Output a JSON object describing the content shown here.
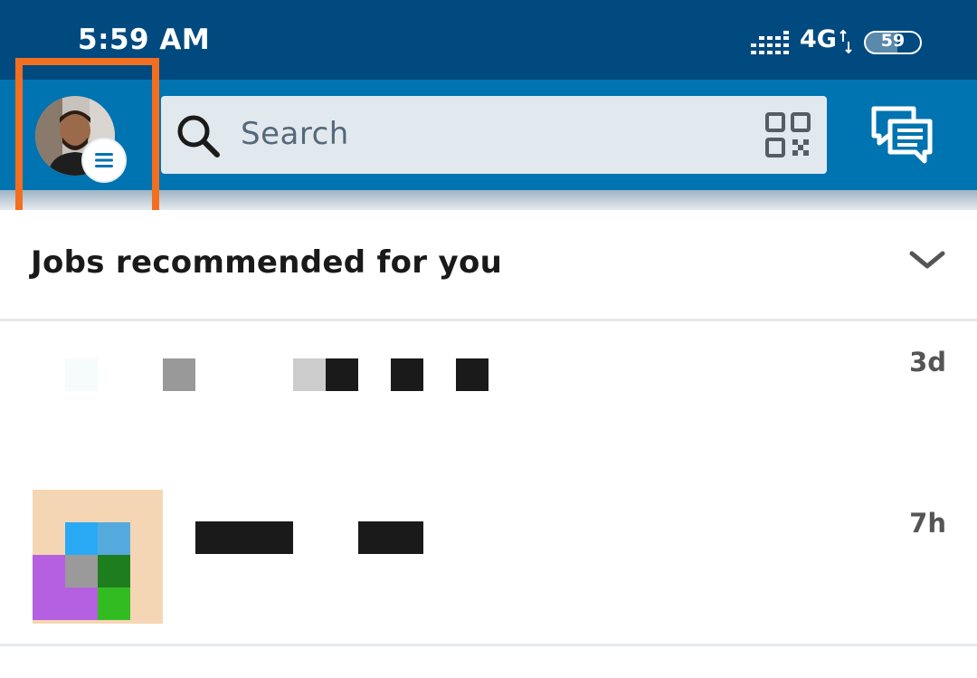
{
  "status_bar": {
    "time": "5:59 AM",
    "network": "4G",
    "battery": "59",
    "battery_level": 0.59
  },
  "header": {
    "avatar_icon": "profile-avatar",
    "menu_icon": "hamburger-menu-icon",
    "search": {
      "placeholder": "Search",
      "icon": "search-icon",
      "qr_icon": "qr-code-icon"
    },
    "messaging_icon": "messaging-icon"
  },
  "section": {
    "title": "Jobs recommended for you",
    "toggle_icon": "chevron-down-icon"
  },
  "notifications": [
    {
      "time": "3d"
    },
    {
      "time": "7h"
    }
  ],
  "colors": {
    "status_bar": "#004a7f",
    "header": "#0073b1",
    "search_bg": "#e1e9ee",
    "highlight": "#f26f21"
  }
}
